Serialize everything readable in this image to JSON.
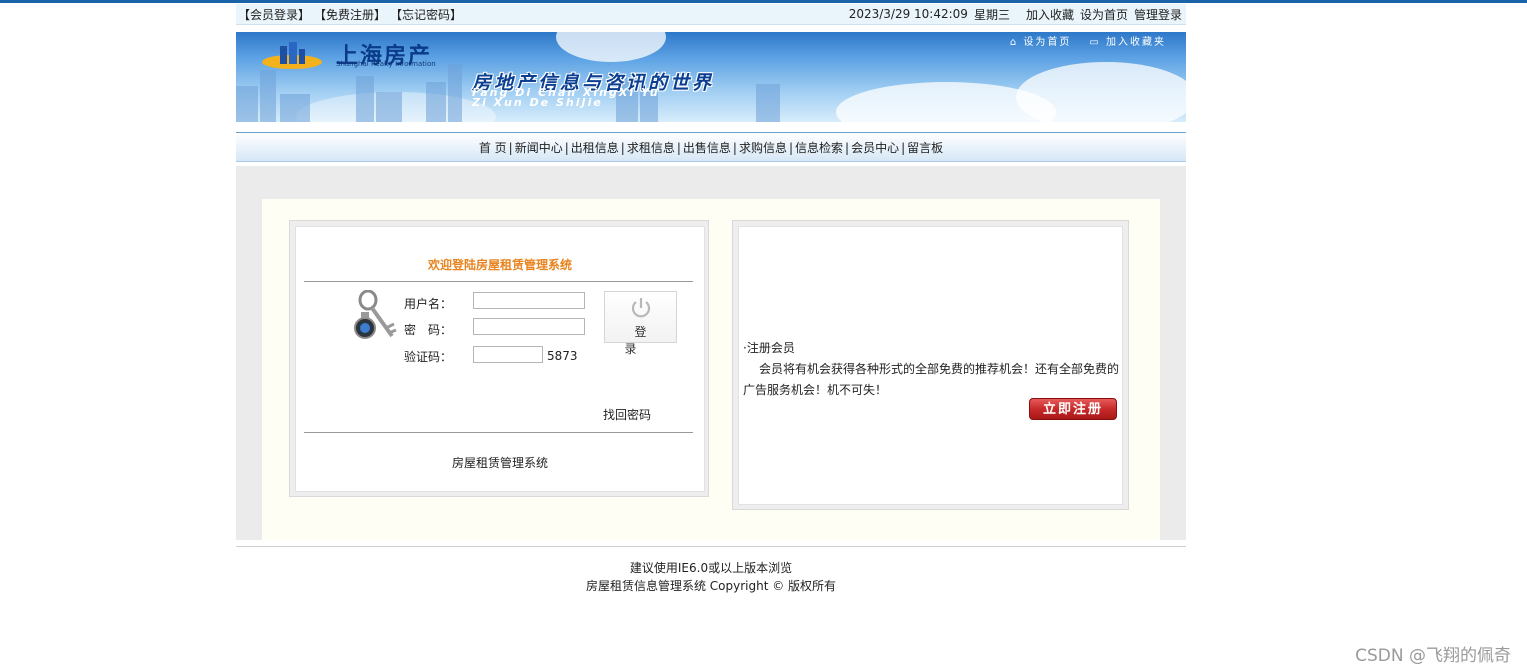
{
  "topbar": {
    "login": "【会员登录】",
    "register": "【免费注册】",
    "forgot": "【忘记密码】",
    "datetime": "2023/3/29 10:42:09",
    "weekday": "星期三",
    "favorite": "加入收藏",
    "homepage": "设为首页",
    "admin": "管理登录"
  },
  "banner": {
    "logo_text": "上海房产",
    "logo_sub": "Shanghai Realty Information",
    "slogan": "房地产信息与咨讯的世界",
    "pinyin1": "Fang Di Chan XingXi Yu",
    "pinyin2": "Zi Xun De ShiJie",
    "set_home": "设为首页",
    "add_fav": "加入收藏夹"
  },
  "nav": {
    "items": [
      {
        "label": "首 页"
      },
      {
        "label": "新闻中心"
      },
      {
        "label": "出租信息"
      },
      {
        "label": "求租信息"
      },
      {
        "label": "出售信息"
      },
      {
        "label": "求购信息"
      },
      {
        "label": "信息检索"
      },
      {
        "label": "会员中心"
      },
      {
        "label": "留言板"
      }
    ]
  },
  "login": {
    "welcome": "欢迎登陆房屋租赁管理系统",
    "username_label": "用户名：",
    "password_label": "密　码：",
    "captcha_label": "验证码：",
    "captcha_value": "5873",
    "username_value": "",
    "password_value": "",
    "captcha_input": "",
    "button_label": "登录",
    "forgot": "找回密码",
    "system_name": "房屋租赁管理系统"
  },
  "register": {
    "title": "·注册会员",
    "desc": "会员将有机会获得各种形式的全部免费的推荐机会！还有全部免费的广告服务机会！机不可失！",
    "button": "立即注册"
  },
  "footer": {
    "line1": "建议使用IE6.0或以上版本浏览",
    "line2": "房屋租赁信息管理系统 Copyright © 版权所有"
  },
  "watermark": "CSDN @飞翔的佩奇",
  "colors": {
    "accent_orange": "#e8841f",
    "nav_border": "#6aa0cf",
    "register_red": "#c72a2a",
    "top_rule": "#1a63a8"
  }
}
